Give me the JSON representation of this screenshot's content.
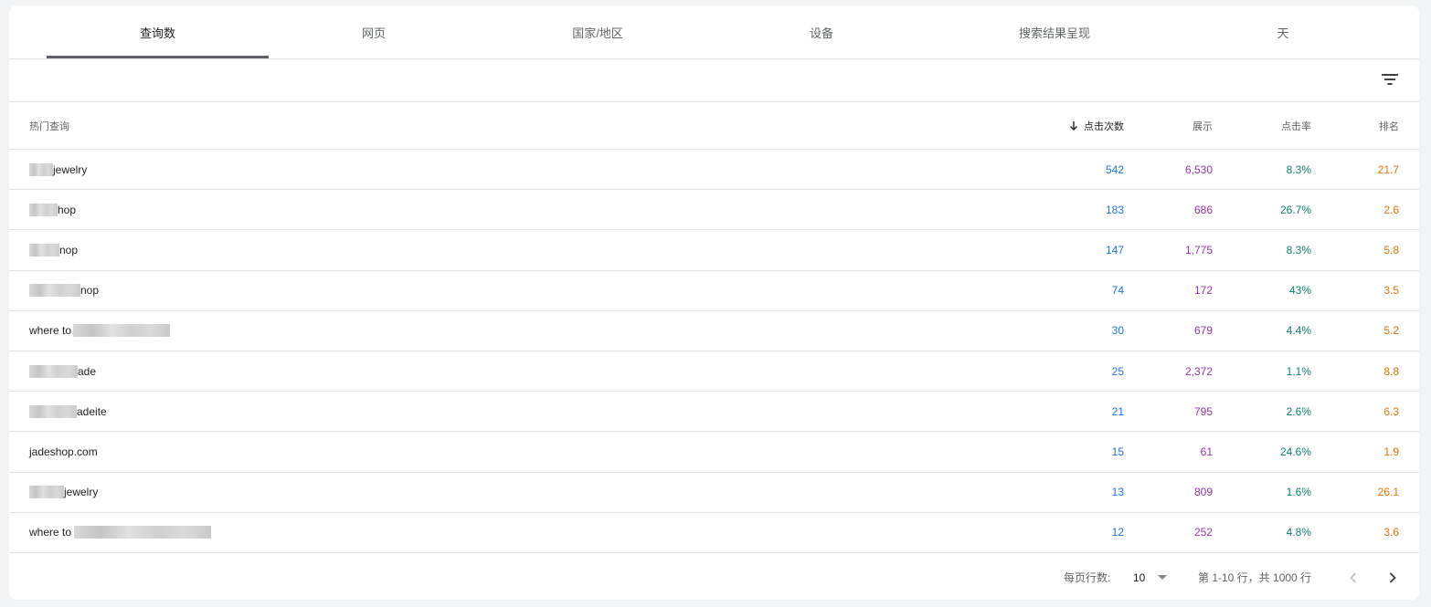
{
  "tabs": [
    {
      "label": "查询数",
      "active": true
    },
    {
      "label": "网页"
    },
    {
      "label": "国家/地区"
    },
    {
      "label": "设备"
    },
    {
      "label": "搜索结果呈现"
    },
    {
      "label": "天"
    }
  ],
  "filter": {
    "icon": "filter-icon"
  },
  "table": {
    "headers": {
      "query": "热门查询",
      "clicks": "点击次数",
      "impressions": "展示",
      "ctr": "点击率",
      "position": "排名"
    },
    "sort_icon": "arrow-down-icon",
    "rows": [
      {
        "query": "jewelry",
        "clicks": "542",
        "impressions": "6,530",
        "ctr": "8.3%",
        "position": "21.7"
      },
      {
        "query": "hop",
        "clicks": "183",
        "impressions": "686",
        "ctr": "26.7%",
        "position": "2.6"
      },
      {
        "query": "nop",
        "clicks": "147",
        "impressions": "1,775",
        "ctr": "8.3%",
        "position": "5.8"
      },
      {
        "query": "nop",
        "clicks": "74",
        "impressions": "172",
        "ctr": "43%",
        "position": "3.5"
      },
      {
        "query": "where to",
        "clicks": "30",
        "impressions": "679",
        "ctr": "4.4%",
        "position": "5.2"
      },
      {
        "query": "ade",
        "clicks": "25",
        "impressions": "2,372",
        "ctr": "1.1%",
        "position": "8.8"
      },
      {
        "query": "adeite",
        "clicks": "21",
        "impressions": "795",
        "ctr": "2.6%",
        "position": "6.3"
      },
      {
        "query": "jadeshop.com",
        "clicks": "15",
        "impressions": "61",
        "ctr": "24.6%",
        "position": "1.9"
      },
      {
        "query": "jewelry",
        "clicks": "13",
        "impressions": "809",
        "ctr": "1.6%",
        "position": "26.1"
      },
      {
        "query": "where to",
        "clicks": "12",
        "impressions": "252",
        "ctr": "4.8%",
        "position": "3.6"
      }
    ]
  },
  "footer": {
    "rows_per_page_label": "每页行数:",
    "rows_per_page_value": "10",
    "range_text": "第 1-10 行，共 1000 行"
  },
  "colors": {
    "clicks": "#1a73e8",
    "impressions": "#9334a8",
    "ctr": "#0a7d6f",
    "position": "#e37400"
  }
}
